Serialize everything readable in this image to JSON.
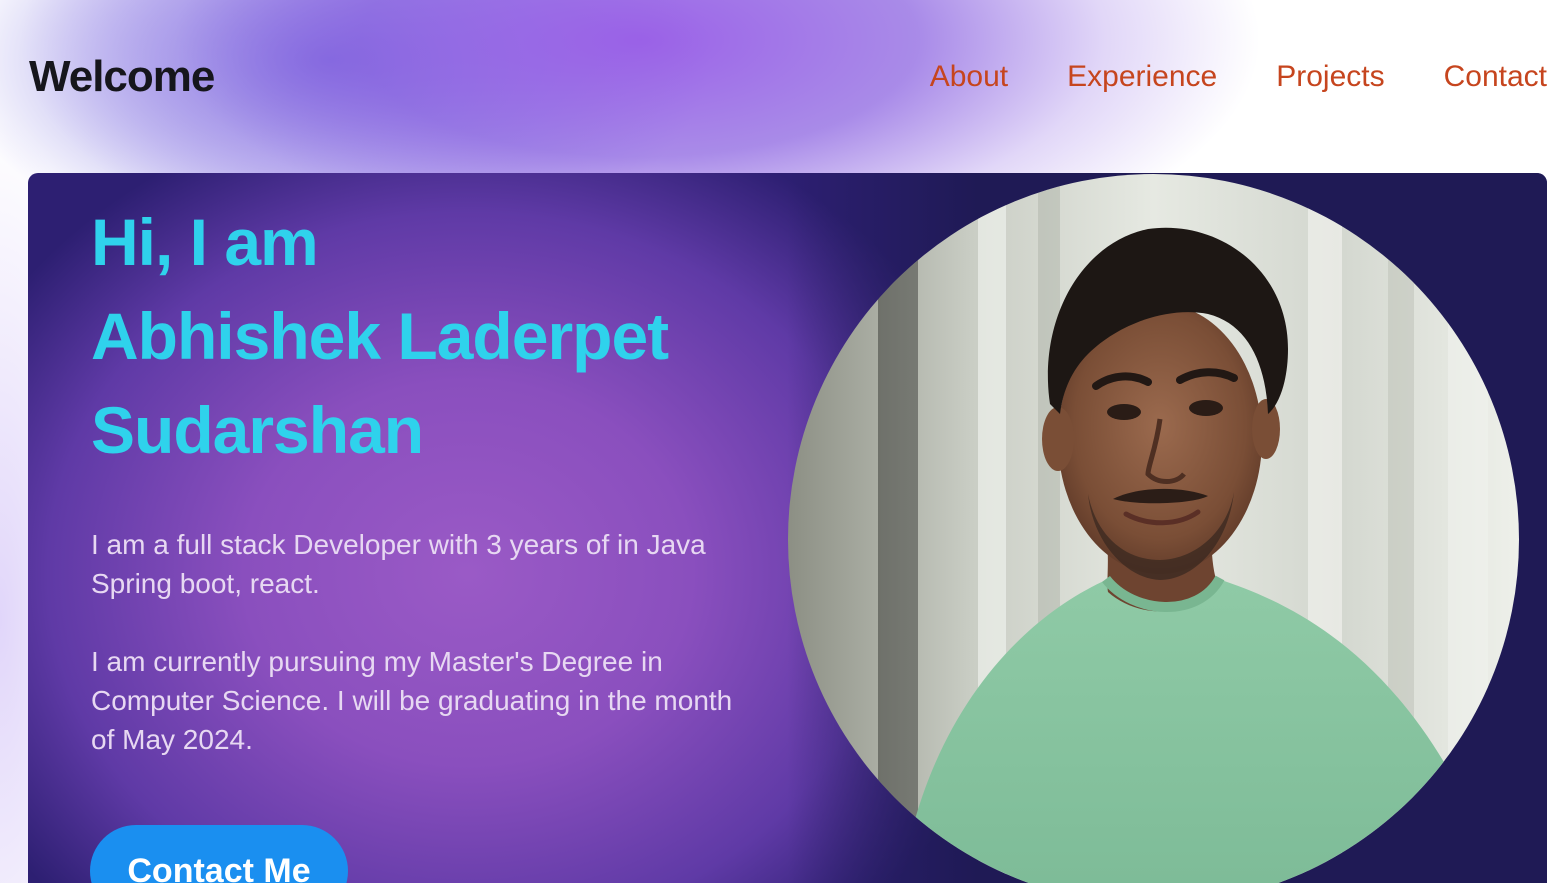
{
  "header": {
    "logo": "Welcome",
    "nav": [
      "About",
      "Experience",
      "Projects",
      "Contact"
    ]
  },
  "hero": {
    "greeting_line1": "Hi, I am",
    "greeting_line2": "Abhishek Laderpet",
    "greeting_line3": "Sudarshan",
    "intro": "I am a full stack Developer with 3 years of in Java Spring boot, react.",
    "education": "I am currently pursuing my Master's Degree in Computer Science. I will be graduating in the month of May 2024.",
    "cta_label": "Contact Me"
  },
  "colors": {
    "nav_link": "#c6451e",
    "greeting": "#2fd2ec",
    "cta": "#1a8ff0"
  }
}
